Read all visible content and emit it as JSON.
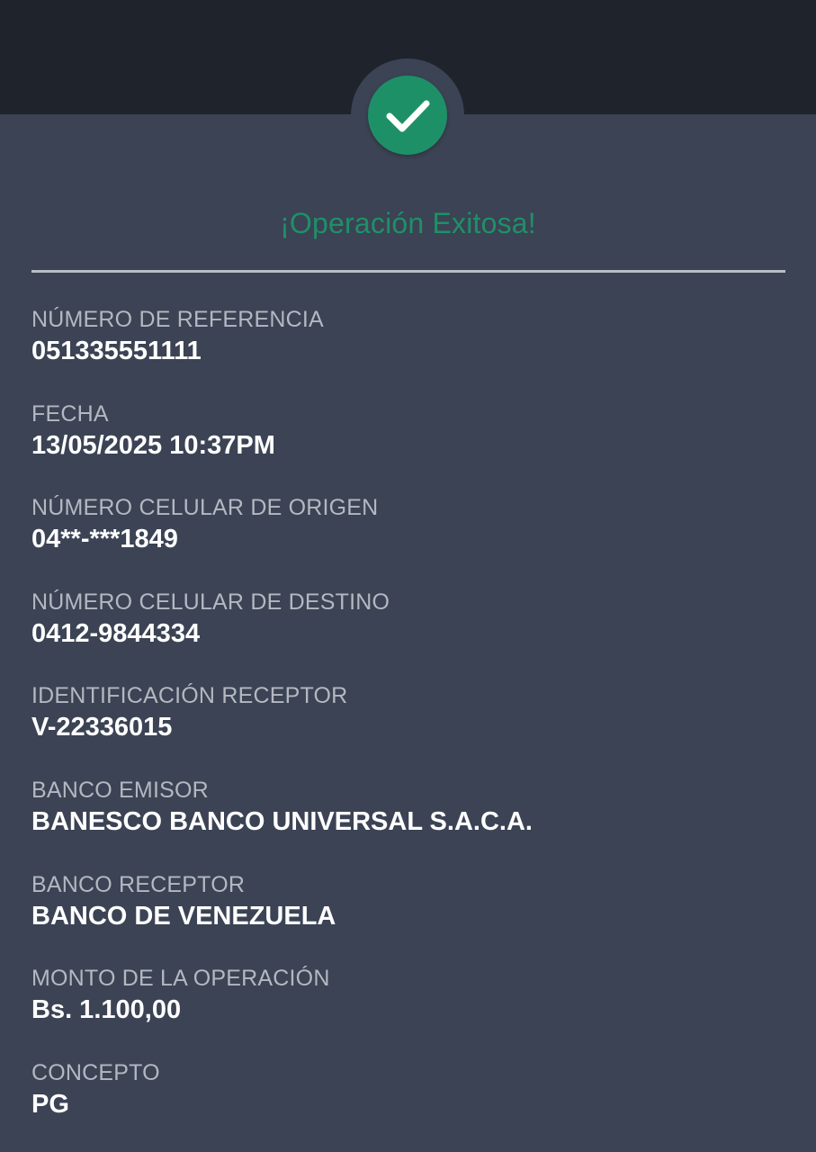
{
  "header": {
    "status_icon": "check-icon",
    "status_title": "¡Operación Exitosa!",
    "colors": {
      "header_bg": "#1f232b",
      "body_bg": "#3b4354",
      "success": "#1e9068",
      "label": "#b3b8c1",
      "value": "#ffffff"
    }
  },
  "details": [
    {
      "label": "NÚMERO DE REFERENCIA",
      "value": "051335551111"
    },
    {
      "label": "FECHA",
      "value": "13/05/2025 10:37PM"
    },
    {
      "label": "NÚMERO CELULAR DE ORIGEN",
      "value": "04**-***1849"
    },
    {
      "label": "NÚMERO CELULAR DE DESTINO",
      "value": "0412-9844334"
    },
    {
      "label": "IDENTIFICACIÓN RECEPTOR",
      "value": "V-22336015"
    },
    {
      "label": "BANCO EMISOR",
      "value": "BANESCO BANCO UNIVERSAL S.A.C.A."
    },
    {
      "label": "BANCO RECEPTOR",
      "value": "BANCO DE VENEZUELA"
    },
    {
      "label": "MONTO DE LA OPERACIÓN",
      "value": "Bs. 1.100,00"
    },
    {
      "label": "CONCEPTO",
      "value": "PG"
    }
  ]
}
